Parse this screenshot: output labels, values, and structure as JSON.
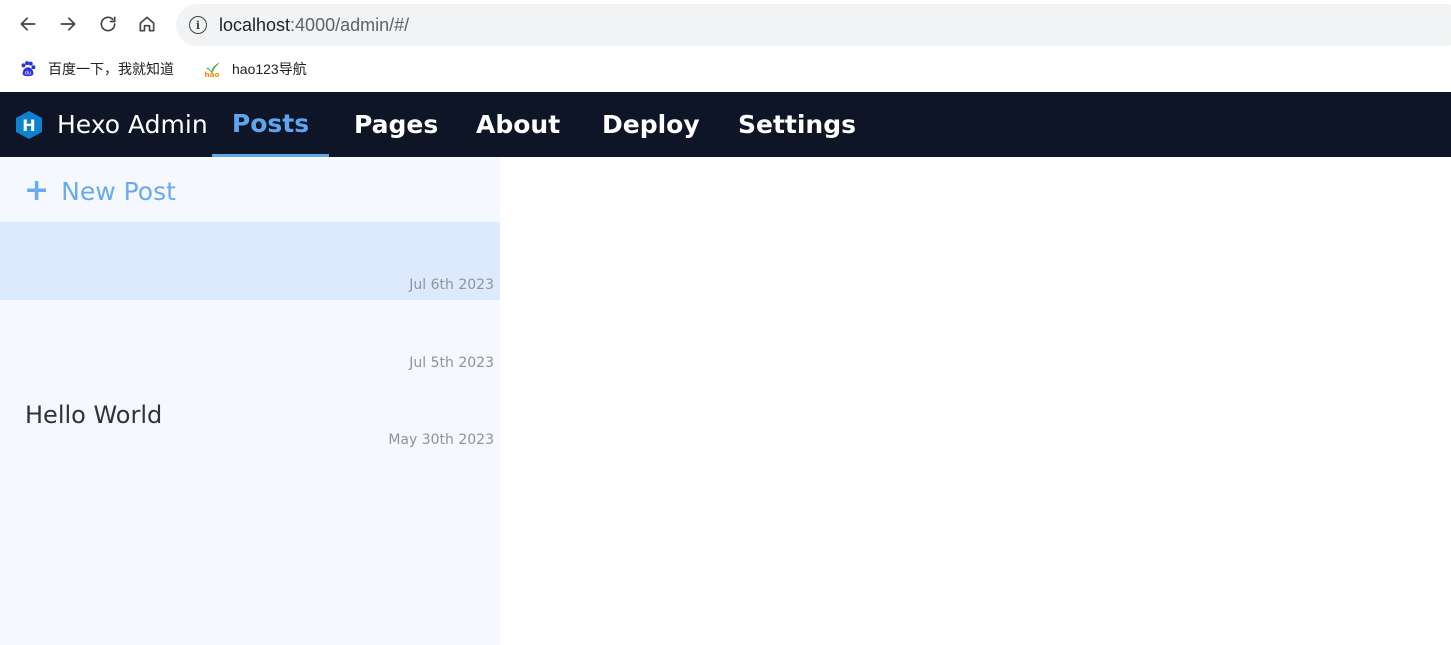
{
  "browser": {
    "url_host": "localhost",
    "url_rest": ":4000/admin/#/",
    "bookmarks": [
      {
        "label": "百度一下，我就知道",
        "icon": "baidu-icon"
      },
      {
        "label": "hao123导航",
        "icon": "hao123-icon"
      }
    ]
  },
  "appbar": {
    "brand_letter": "H",
    "brand_name": "Hexo Admin",
    "tabs": [
      {
        "label": "Posts",
        "active": true
      },
      {
        "label": "Pages",
        "active": false
      },
      {
        "label": "About",
        "active": false
      },
      {
        "label": "Deploy",
        "active": false
      },
      {
        "label": "Settings",
        "active": false
      }
    ],
    "colors": {
      "background": "#0d1526",
      "active": "#5ea5ef"
    }
  },
  "sidebar": {
    "new_post_label": "New Post",
    "posts": [
      {
        "title": "",
        "date": "Jul 6th 2023",
        "selected": true
      },
      {
        "title": "",
        "date": "Jul 5th 2023",
        "selected": false
      },
      {
        "title": "Hello World",
        "date": "May 30th 2023",
        "selected": false
      }
    ]
  }
}
